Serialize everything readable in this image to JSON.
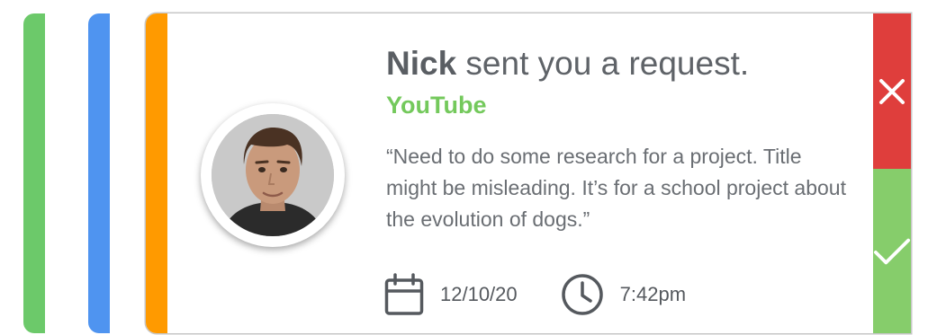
{
  "notification": {
    "sender_name": "Nick",
    "title_rest": " sent you a request.",
    "platform": "YouTube",
    "message": "“Need to do some research for a project. Title might be misleading. It’s for a school project about the evolution of dogs.”",
    "date": "12/10/20",
    "time": "7:42pm"
  },
  "icons": {
    "calendar": "calendar-icon",
    "clock": "clock-icon",
    "decline": "close-icon",
    "accept": "checkmark-icon"
  },
  "colors": {
    "card_accent": "#ff9a00",
    "stack_green": "#6cc96a",
    "stack_blue": "#4f94f0",
    "platform": "#74c95c",
    "decline": "#df3e3c",
    "accept": "#86cd6b"
  }
}
